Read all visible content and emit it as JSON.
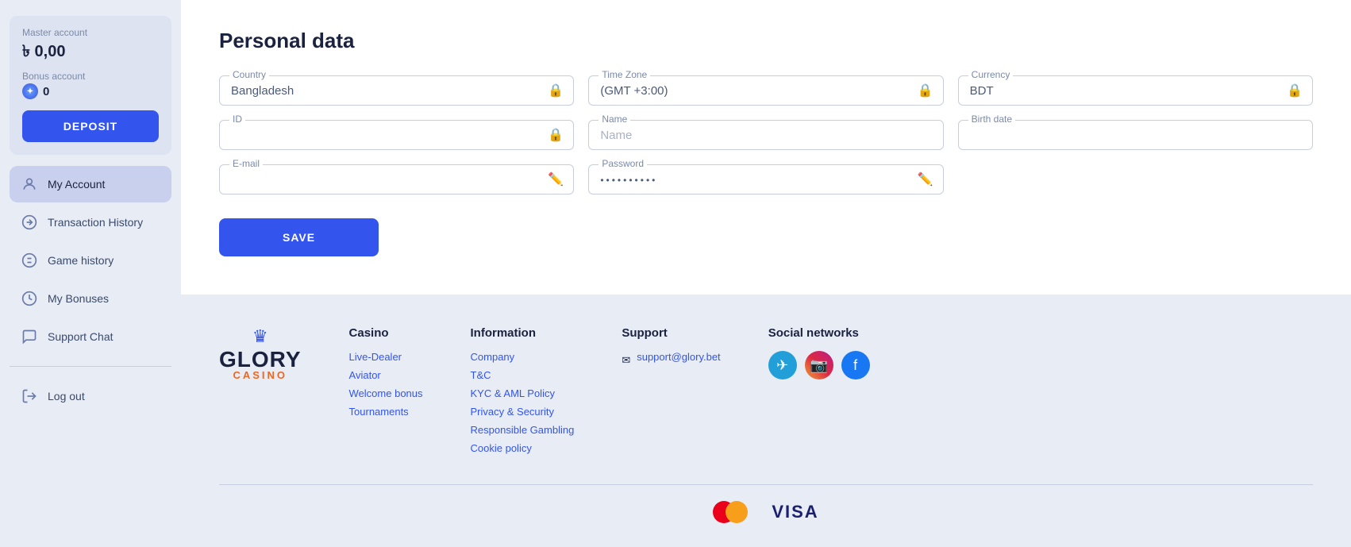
{
  "sidebar": {
    "master_label": "Master account",
    "balance": "৳ 0,00",
    "bonus_label": "Bonus account",
    "bonus_value": "0",
    "deposit_btn": "DEPOSIT",
    "nav_items": [
      {
        "id": "my-account",
        "label": "My Account",
        "active": true
      },
      {
        "id": "transaction-history",
        "label": "Transaction History",
        "active": false
      },
      {
        "id": "game-history",
        "label": "Game history",
        "active": false
      },
      {
        "id": "my-bonuses",
        "label": "My Bonuses",
        "active": false
      },
      {
        "id": "support-chat",
        "label": "Support Chat",
        "active": false
      }
    ],
    "logout_label": "Log out"
  },
  "personal_data": {
    "title": "Personal data",
    "fields": {
      "country_label": "Country",
      "country_value": "Bangladesh",
      "timezone_label": "Time Zone",
      "timezone_value": "(GMT +3:00)",
      "currency_label": "Currency",
      "currency_value": "BDT",
      "id_label": "ID",
      "id_value": "",
      "name_label": "Name",
      "name_placeholder": "Name",
      "birthdate_label": "Birth date",
      "birthdate_placeholder": "",
      "email_label": "E-mail",
      "email_value": "",
      "password_label": "Password",
      "password_value": "••••••••••"
    },
    "save_btn": "SAVE"
  },
  "footer": {
    "logo_main": "GLORY",
    "logo_sub": "CASINO",
    "casino_col": {
      "title": "Casino",
      "links": [
        "Live-Dealer",
        "Aviator",
        "Welcome bonus",
        "Tournaments"
      ]
    },
    "information_col": {
      "title": "Information",
      "links": [
        "Company",
        "T&C",
        "KYC & AML Policy",
        "Privacy & Security",
        "Responsible Gambling",
        "Cookie policy"
      ]
    },
    "support_col": {
      "title": "Support",
      "email": "support@glory.bet"
    },
    "social_col": {
      "title": "Social networks"
    }
  }
}
